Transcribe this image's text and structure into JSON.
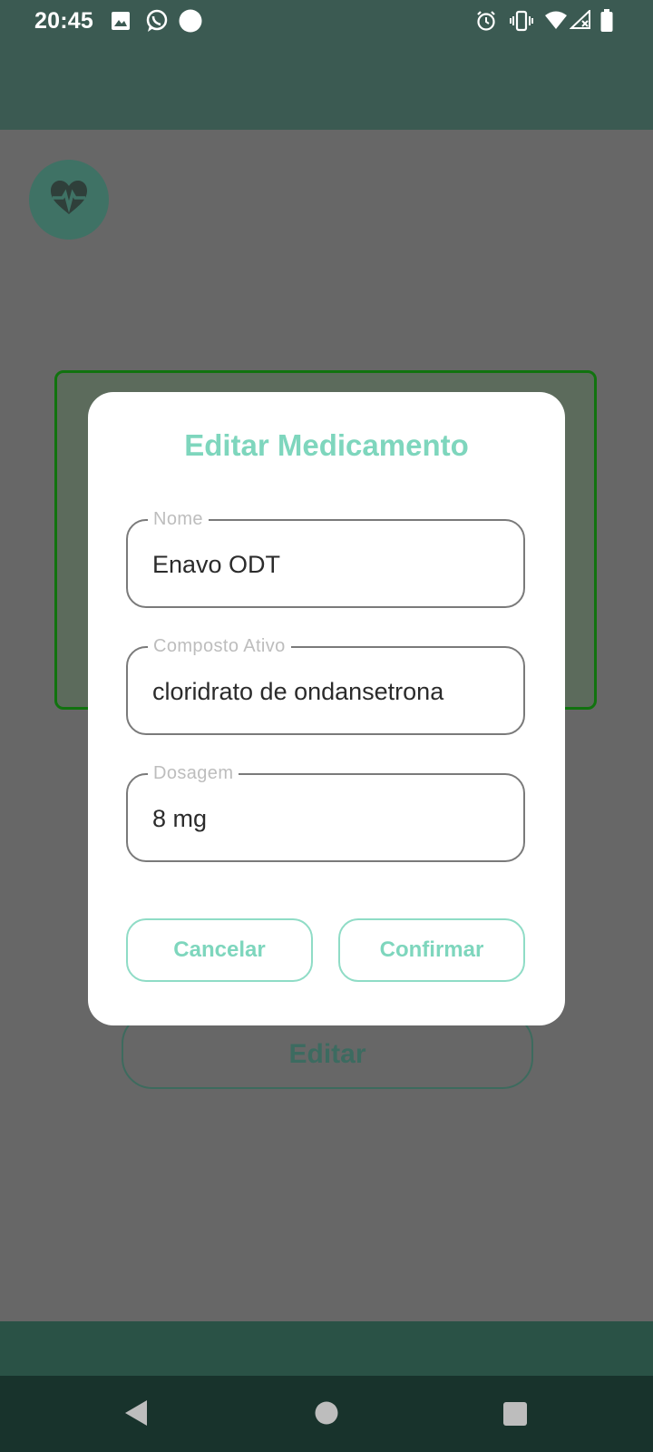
{
  "status_bar": {
    "time": "20:45",
    "left_icons": [
      "image-icon",
      "whatsapp-icon",
      "circle-notification-icon"
    ],
    "right_icons": [
      "alarm-icon",
      "vibrate-icon",
      "wifi-icon",
      "signal-icon",
      "battery-icon"
    ]
  },
  "app": {
    "logo_icon": "heart-pulse-icon",
    "edit_button_label": "Editar"
  },
  "dialog": {
    "title": "Editar Medicamento",
    "fields": [
      {
        "label": "Nome",
        "value": "Enavo ODT"
      },
      {
        "label": "Composto Ativo",
        "value": "cloridrato de ondansetrona"
      },
      {
        "label": "Dosagem",
        "value": "8 mg"
      }
    ],
    "cancel_label": "Cancelar",
    "confirm_label": "Confirmar"
  },
  "colors": {
    "app_bar": "#3b5a52",
    "accent": "#7ed6bd",
    "card_border": "#11730f",
    "scrim_background": "#676767",
    "nav_bar": "#18332c"
  },
  "nav_bar": {
    "icons": [
      "back-icon",
      "home-icon",
      "recents-icon"
    ]
  }
}
